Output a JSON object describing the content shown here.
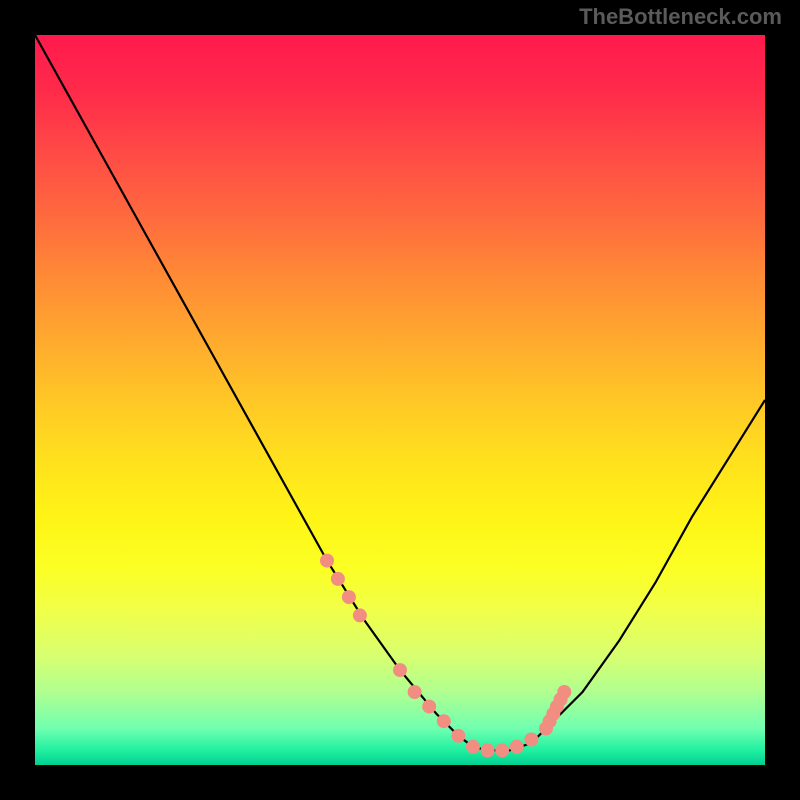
{
  "watermark": "TheBottleneck.com",
  "chart_data": {
    "type": "line",
    "title": "",
    "xlabel": "",
    "ylabel": "",
    "xlim": [
      0,
      100
    ],
    "ylim": [
      0,
      100
    ],
    "series": [
      {
        "name": "curve",
        "x": [
          0,
          5,
          10,
          15,
          20,
          25,
          30,
          35,
          40,
          45,
          50,
          55,
          58,
          60,
          62,
          65,
          68,
          70,
          75,
          80,
          85,
          90,
          95,
          100
        ],
        "y": [
          100,
          91,
          82,
          73,
          64,
          55,
          46,
          37,
          28,
          20,
          13,
          7,
          4,
          2.5,
          2,
          2,
          3,
          5,
          10,
          17,
          25,
          34,
          42,
          50
        ]
      }
    ],
    "markers": {
      "name": "dots",
      "color": "#f28d82",
      "x": [
        40,
        41.5,
        43,
        44.5,
        50,
        52,
        54,
        56,
        58,
        60,
        62,
        64,
        66,
        68,
        70,
        70.5,
        71,
        71.5,
        72,
        72.5
      ],
      "y": [
        28,
        25.5,
        23,
        20.5,
        13,
        10,
        8,
        6,
        4,
        2.5,
        2,
        2,
        2.5,
        3.5,
        5,
        6,
        7,
        8,
        9,
        10
      ]
    },
    "gradient_stops": [
      {
        "pos": 0,
        "color": "#ff1a4d"
      },
      {
        "pos": 50,
        "color": "#ffc726"
      },
      {
        "pos": 80,
        "color": "#f0ff4a"
      },
      {
        "pos": 100,
        "color": "#00d090"
      }
    ]
  }
}
